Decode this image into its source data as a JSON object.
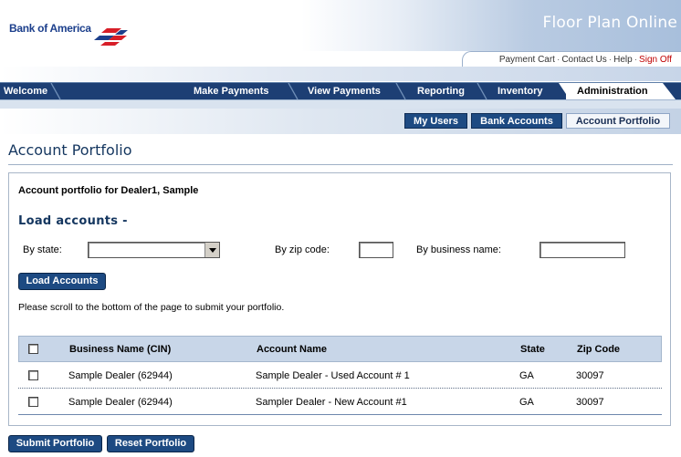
{
  "brand": {
    "name": "Bank of America",
    "app_title": "Floor Plan Online"
  },
  "util_links": {
    "payment_cart": "Payment Cart",
    "contact_us": "Contact Us",
    "help": "Help",
    "sign_off": "Sign Off",
    "separator": "·"
  },
  "nav": {
    "items": [
      {
        "label": "Welcome"
      },
      {
        "label": "Make Payments"
      },
      {
        "label": "View Payments"
      },
      {
        "label": "Reporting"
      },
      {
        "label": "Inventory"
      },
      {
        "label": "Administration",
        "active": true
      }
    ]
  },
  "subnav": {
    "items": [
      {
        "label": "My Users"
      },
      {
        "label": "Bank Accounts"
      },
      {
        "label": "Account Portfolio",
        "active": true
      }
    ]
  },
  "page": {
    "title": "Account Portfolio",
    "owner_line": "Account portfolio for Dealer1, Sample",
    "section_title": "Load accounts -",
    "filters": {
      "state_label": "By state:",
      "state_value": "",
      "zip_label": "By zip code:",
      "zip_value": "",
      "business_label": "By business name:",
      "business_value": ""
    },
    "load_button": "Load Accounts",
    "note": "Please scroll to the bottom of the page to submit your portfolio."
  },
  "table": {
    "headers": {
      "business": "Business Name (CIN)",
      "account": "Account Name",
      "state": "State",
      "zip": "Zip Code"
    },
    "rows": [
      {
        "business": "Sample Dealer (62944)",
        "account": "Sample Dealer - Used Account # 1",
        "state": "GA",
        "zip": "30097",
        "checked": false
      },
      {
        "business": "Sample Dealer (62944)",
        "account": "Sampler Dealer - New Account #1",
        "state": "GA",
        "zip": "30097",
        "checked": false
      }
    ]
  },
  "actions": {
    "submit": "Submit Portfolio",
    "reset": "Reset Portfolio"
  },
  "colors": {
    "nav_bg": "#1d3f74",
    "button_bg": "#1d4a82",
    "title_text": "#14365f",
    "sign_off": "#c00000",
    "logo_red": "#d71e28",
    "logo_blue": "#1c3f8c"
  }
}
